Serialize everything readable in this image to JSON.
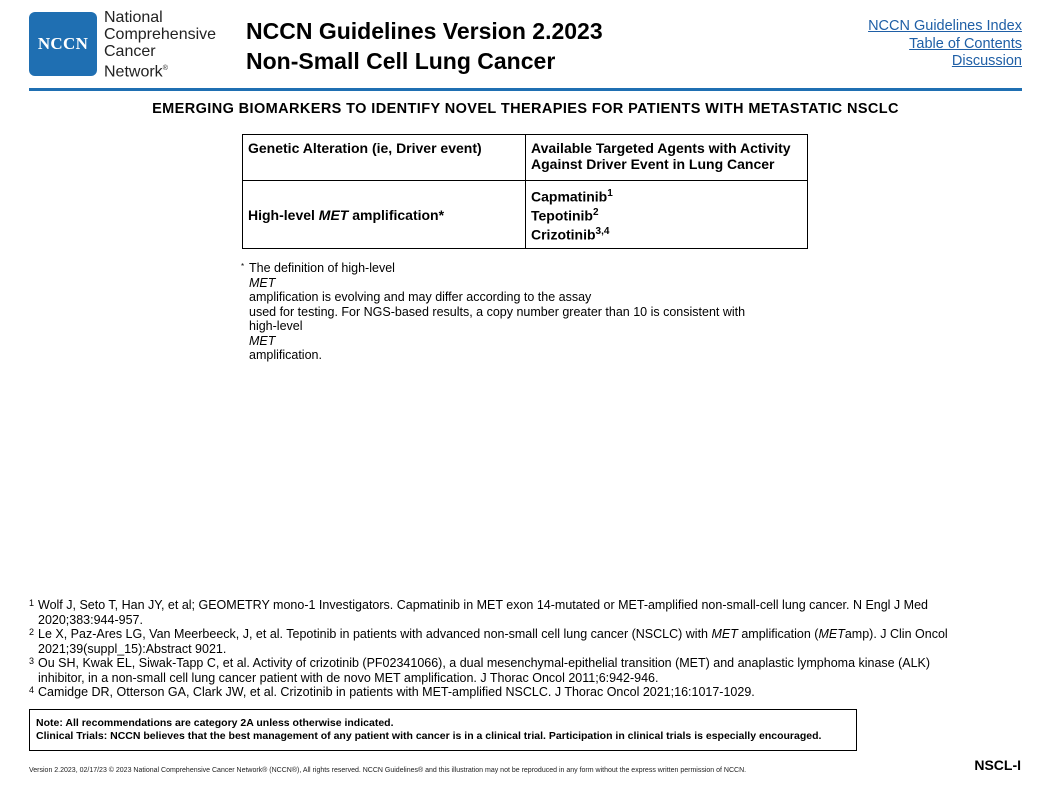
{
  "header": {
    "logo_text": "NCCN",
    "org_lines": [
      "National",
      "Comprehensive",
      "Cancer",
      "Network"
    ],
    "org_mark": "®",
    "title_line1": "NCCN Guidelines Version 2.2023",
    "title_line2": "Non-Small Cell Lung Cancer",
    "links": [
      "NCCN Guidelines Index",
      "Table of Contents",
      "Discussion"
    ]
  },
  "section_title": "EMERGING BIOMARKERS TO IDENTIFY NOVEL THERAPIES FOR PATIENTS WITH METASTATIC NSCLC",
  "table": {
    "col1_header": "Genetic Alteration (ie, Driver event)",
    "col2_header_line1": "Available Targeted Agents with Activity",
    "col2_header_line2": "Against Driver Event in Lung Cancer",
    "row": {
      "alteration_prefix": "High-level ",
      "alteration_gene": "MET",
      "alteration_suffix": " amplification*",
      "agents": [
        {
          "name": "Capmatinib",
          "ref": "1"
        },
        {
          "name": "Tepotinib",
          "ref": "2"
        },
        {
          "name": "Crizotinib",
          "ref": "3,4"
        }
      ]
    }
  },
  "footnote": {
    "mark": "*",
    "line1_a": "The definition of high-level ",
    "line1_gene": "MET",
    "line1_b": " amplification is evolving and may differ according to the assay",
    "line2": "used for testing. For NGS-based results, a copy number greater than 10 is consistent with",
    "line3_a": "high-level ",
    "line3_gene": "MET",
    "line3_b": " amplification."
  },
  "references": [
    {
      "num": "1",
      "line1": "Wolf J, Seto T, Han JY, et al; GEOMETRY mono-1 Investigators. Capmatinib in MET exon 14-mutated or MET-amplified non-small-cell lung cancer. N Engl J Med",
      "line2": "2020;383:944-957."
    },
    {
      "num": "2",
      "line1_a": "Le X, Paz-Ares LG, Van Meerbeeck, J, et al. Tepotinib in patients with advanced non-small cell lung cancer (NSCLC) with ",
      "line1_gene": "MET",
      "line1_b": " amplification (",
      "line1_gene2": "MET",
      "line1_c": "amp). J Clin Oncol",
      "line2": "2021;39(suppl_15):Abstract 9021."
    },
    {
      "num": "3",
      "line1": "Ou SH, Kwak EL, Siwak-Tapp C, et al. Activity of crizotinib (PF02341066), a dual mesenchymal-epithelial transition (MET) and anaplastic lymphoma kinase (ALK)",
      "line2": "inhibitor, in a non-small cell lung cancer patient with de novo MET amplification. J Thorac Oncol 2011;6:942-946."
    },
    {
      "num": "4",
      "line1": "Camidge DR, Otterson GA, Clark JW, et al. Crizotinib in patients with MET-amplified NSCLC. J Thorac Oncol 2021;16:1017-1029."
    }
  ],
  "note_box": {
    "line1": "Note: All recommendations are category 2A unless otherwise indicated.",
    "line2": "Clinical Trials: NCCN believes that the best management of any patient with cancer is in a clinical trial. Participation in clinical trials is especially encouraged."
  },
  "footer": {
    "copyright": "Version 2.2023, 02/17/23 © 2023 National Comprehensive Cancer Network® (NCCN®), All rights reserved. NCCN Guidelines® and this illustration may not be reproduced in any form without the express written permission of NCCN.",
    "page_id": "NSCL-I"
  }
}
